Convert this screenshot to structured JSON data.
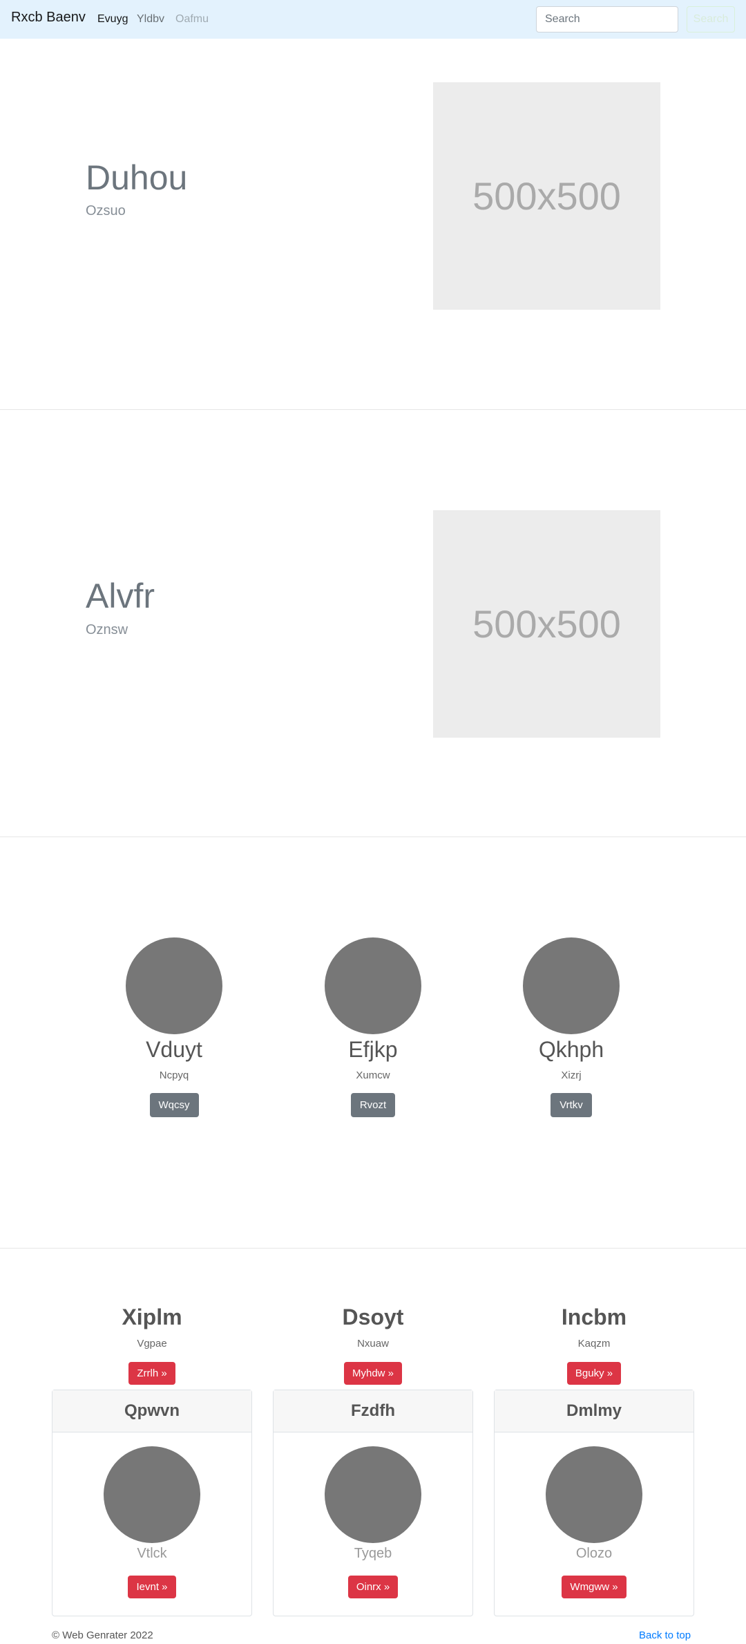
{
  "navbar": {
    "brand": "Rxcb Baenv",
    "links": [
      "Evuyg",
      "Yldbv",
      "Oafmu"
    ],
    "search_placeholder": "Search",
    "search_button": "Search"
  },
  "heroes": [
    {
      "title": "Duhou",
      "subtitle": "Ozsuo",
      "image_text": "500x500"
    },
    {
      "title": "Alvfr",
      "subtitle": "Oznsw",
      "image_text": "500x500"
    }
  ],
  "features": [
    {
      "title": "Vduyt",
      "subtitle": "Ncpyq",
      "button": "Wqcsy"
    },
    {
      "title": "Efjkp",
      "subtitle": "Xumcw",
      "button": "Rvozt"
    },
    {
      "title": "Qkhph",
      "subtitle": "Xizrj",
      "button": "Vrtkv"
    }
  ],
  "promos": [
    {
      "title": "Xiplm",
      "subtitle": "Vgpae",
      "button": "Zrrlh »"
    },
    {
      "title": "Dsoyt",
      "subtitle": "Nxuaw",
      "button": "Myhdw »"
    },
    {
      "title": "Incbm",
      "subtitle": "Kaqzm",
      "button": "Bguky »"
    }
  ],
  "cards": [
    {
      "header": "Qpwvn",
      "text": "Vtlck",
      "button": "Ievnt »"
    },
    {
      "header": "Fzdfh",
      "text": "Tyqeb",
      "button": "Oinrx »"
    },
    {
      "header": "Dmlmy",
      "text": "Olozo",
      "button": "Wmgww »"
    }
  ],
  "footer": {
    "copyright": "© Web Genrater 2022",
    "back_to_top": "Back to top"
  },
  "colors": {
    "navbar_bg": "#e3f2fd",
    "danger": "#dc3545",
    "secondary": "#6c757d",
    "link": "#007bff"
  }
}
